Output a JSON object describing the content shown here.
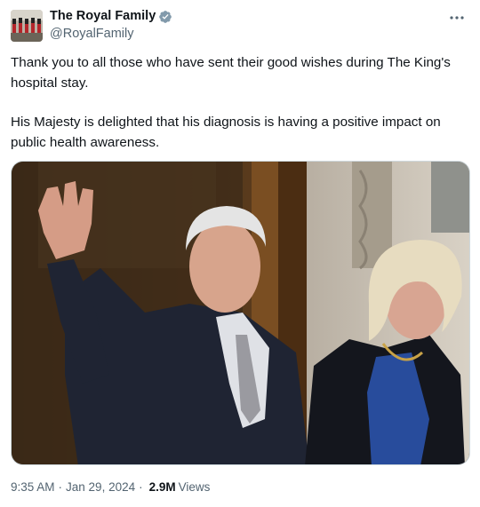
{
  "author": {
    "name": "The Royal Family",
    "handle": "@RoyalFamily",
    "verified": true,
    "avatar_icon": "guards-avatar-icon",
    "verified_color": "#829aab"
  },
  "tweet": {
    "paragraph_1": "Thank you to all those who have sent their good wishes during The King's hospital stay.",
    "paragraph_2": "His Majesty is delighted that his diagnosis is having a positive impact on public health awareness."
  },
  "meta": {
    "time": "9:35 AM",
    "date": "Jan 29, 2024",
    "views_count": "2.9M",
    "views_label": "Views",
    "separator": "·"
  },
  "icons": {
    "more": "more-options-icon",
    "verified": "verified-badge-icon"
  },
  "colors": {
    "text": "#0f1419",
    "secondary": "#536471",
    "border": "#cfd9de"
  }
}
